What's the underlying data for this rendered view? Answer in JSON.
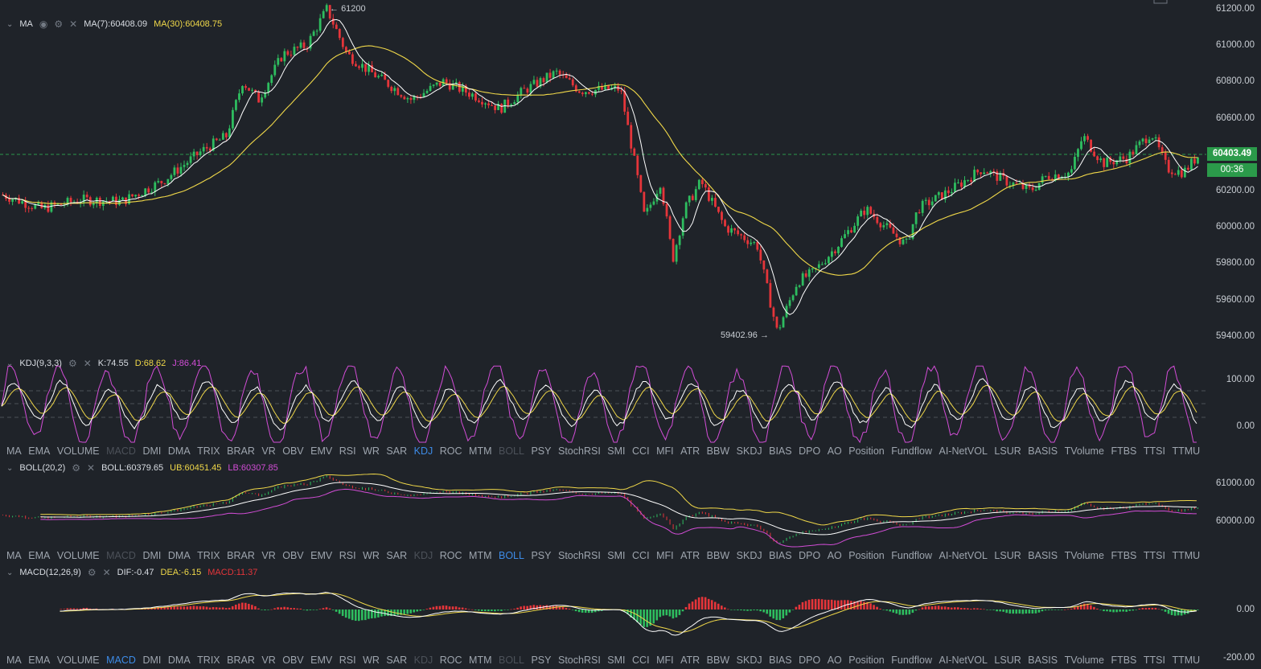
{
  "main": {
    "indicator": "MA",
    "ma7_label": "MA(7):60408.09",
    "ma30_label": "MA(30):60408.75",
    "y_ticks": [
      "61200.00",
      "61000.00",
      "60800.00",
      "60600.00",
      "60200.00",
      "60000.00",
      "59800.00",
      "59600.00",
      "59400.00"
    ],
    "current_price": "60403.49",
    "countdown": "00:36",
    "high_annotation": "61200",
    "low_annotation": "59402.96",
    "colors": {
      "up": "#2ebd5f",
      "down": "#e5353a",
      "ma7": "#ffffff",
      "ma30": "#f0d849",
      "current": "#2b9a4a"
    }
  },
  "kdj": {
    "name": "KDJ(9,3,3)",
    "k_label": "K:74.55",
    "d_label": "D:68.62",
    "j_label": "J:86.41",
    "y_ticks": [
      "100.00",
      "0.00"
    ]
  },
  "boll": {
    "name": "BOLL(20,2)",
    "boll_label": "BOLL:60379.65",
    "ub_label": "UB:60451.45",
    "lb_label": "LB:60307.85",
    "y_ticks": [
      "61000.00",
      "60000.00"
    ]
  },
  "macd": {
    "name": "MACD(12,26,9)",
    "dif_label": "DIF:-0.47",
    "dea_label": "DEA:-6.15",
    "macd_label": "MACD:11.37",
    "y_ticks": [
      "0.00",
      "-200.00"
    ]
  },
  "tabs1": {
    "items": [
      "MA",
      "EMA",
      "VOLUME",
      "MACD",
      "DMI",
      "DMA",
      "TRIX",
      "BRAR",
      "VR",
      "OBV",
      "EMV",
      "RSI",
      "WR",
      "SAR",
      "KDJ",
      "ROC",
      "MTM",
      "BOLL",
      "PSY",
      "StochRSI",
      "SMI",
      "CCI",
      "MFI",
      "ATR",
      "BBW",
      "SKDJ",
      "BIAS",
      "DPO",
      "AO",
      "Position",
      "Fundflow",
      "AI-NetVOL",
      "LSUR",
      "BASIS",
      "TVolume",
      "FTBS",
      "TTSI",
      "TTMU"
    ],
    "active": "KDJ",
    "dimmed": [
      "MACD",
      "BOLL"
    ]
  },
  "tabs2": {
    "items": [
      "MA",
      "EMA",
      "VOLUME",
      "MACD",
      "DMI",
      "DMA",
      "TRIX",
      "BRAR",
      "VR",
      "OBV",
      "EMV",
      "RSI",
      "WR",
      "SAR",
      "KDJ",
      "ROC",
      "MTM",
      "BOLL",
      "PSY",
      "StochRSI",
      "SMI",
      "CCI",
      "MFI",
      "ATR",
      "BBW",
      "SKDJ",
      "BIAS",
      "DPO",
      "AO",
      "Position",
      "Fundflow",
      "AI-NetVOL",
      "LSUR",
      "BASIS",
      "TVolume",
      "FTBS",
      "TTSI",
      "TTMU"
    ],
    "active": "BOLL",
    "dimmed": [
      "MACD",
      "KDJ"
    ]
  },
  "tabs3": {
    "items": [
      "MA",
      "EMA",
      "VOLUME",
      "MACD",
      "DMI",
      "DMA",
      "TRIX",
      "BRAR",
      "VR",
      "OBV",
      "EMV",
      "RSI",
      "WR",
      "SAR",
      "KDJ",
      "ROC",
      "MTM",
      "BOLL",
      "PSY",
      "StochRSI",
      "SMI",
      "CCI",
      "MFI",
      "ATR",
      "BBW",
      "SKDJ",
      "BIAS",
      "DPO",
      "AO",
      "Position",
      "Fundflow",
      "AI-NetVOL",
      "LSUR",
      "BASIS",
      "TVolume",
      "FTBS",
      "TTSI",
      "TTMU"
    ],
    "active": "MACD",
    "dimmed": [
      "KDJ",
      "BOLL"
    ]
  },
  "icons": {
    "chevron": "chevron-down-icon",
    "eye": "eye-icon",
    "settings": "settings-icon",
    "close": "close-icon"
  }
}
